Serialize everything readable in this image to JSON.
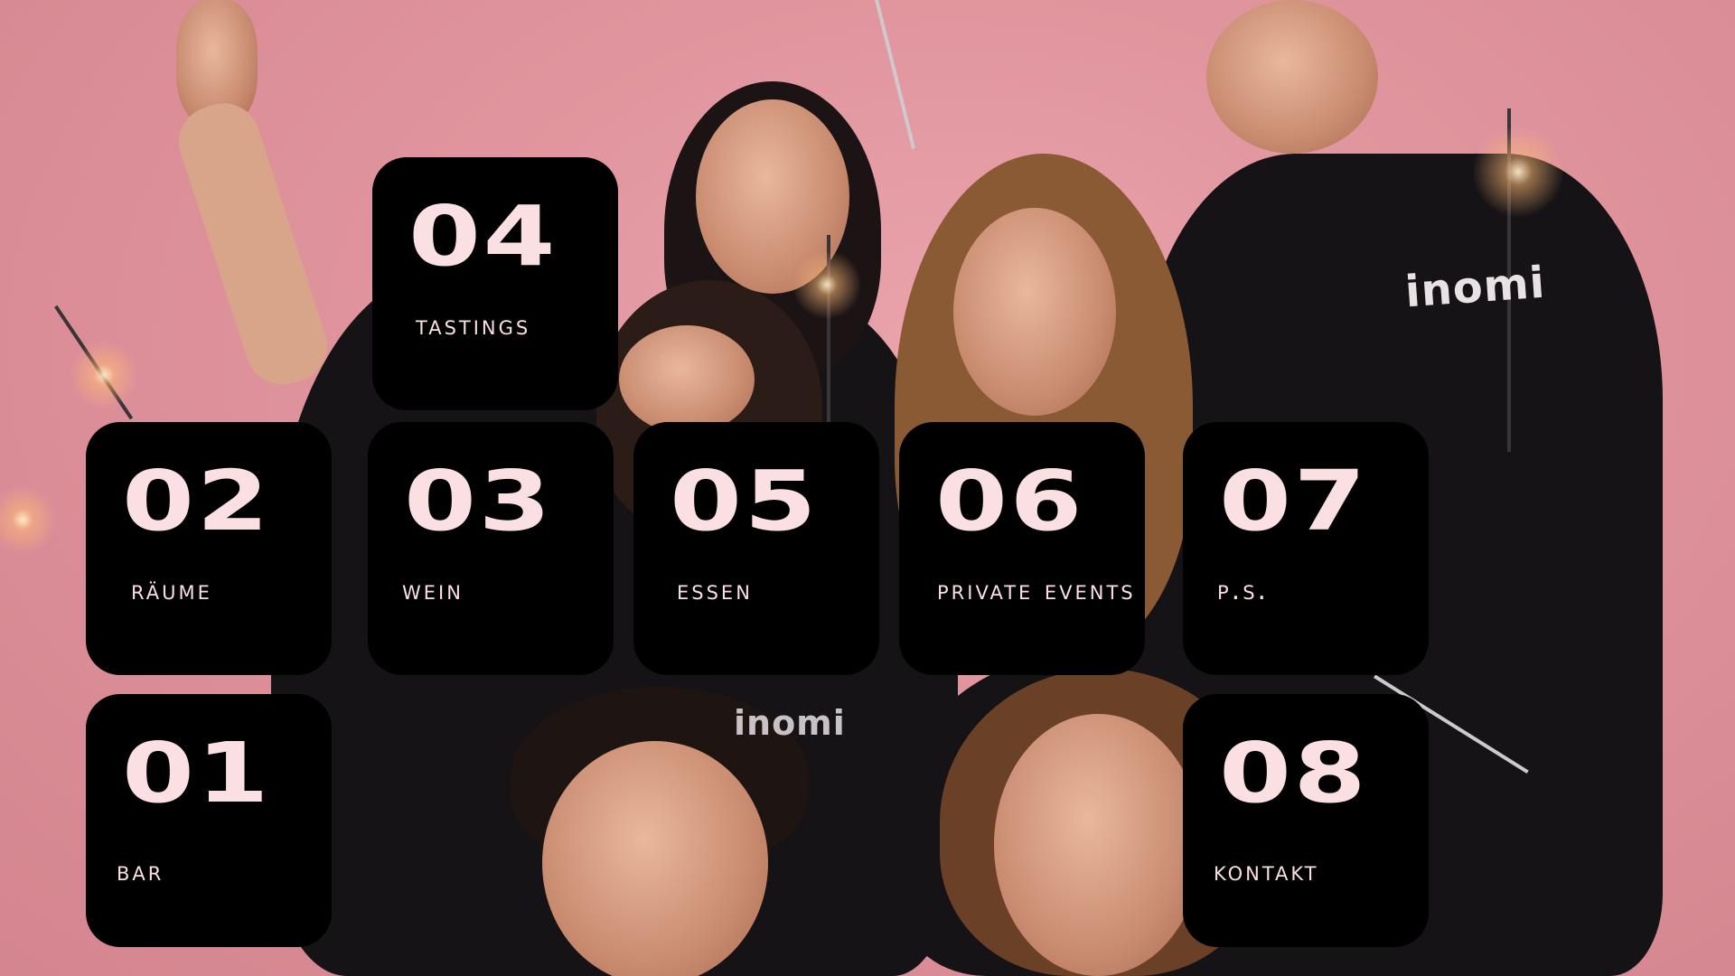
{
  "hero": {
    "photo_icon": "group-photo-sparklers",
    "jumpsuit_logo": "inomi"
  },
  "tiles": [
    {
      "number": "04",
      "label": "Tastings"
    },
    {
      "number": "02",
      "label": "Räume"
    },
    {
      "number": "03",
      "label": "Wein"
    },
    {
      "number": "05",
      "label": "Essen"
    },
    {
      "number": "06",
      "label": "Private Events"
    },
    {
      "number": "07",
      "label": "P.S."
    },
    {
      "number": "01",
      "label": "Bar"
    },
    {
      "number": "08",
      "label": "Kontakt"
    }
  ],
  "colors": {
    "tile_bg": "#000000",
    "tile_text": "#fadfe3",
    "backdrop": "#e0959e"
  }
}
